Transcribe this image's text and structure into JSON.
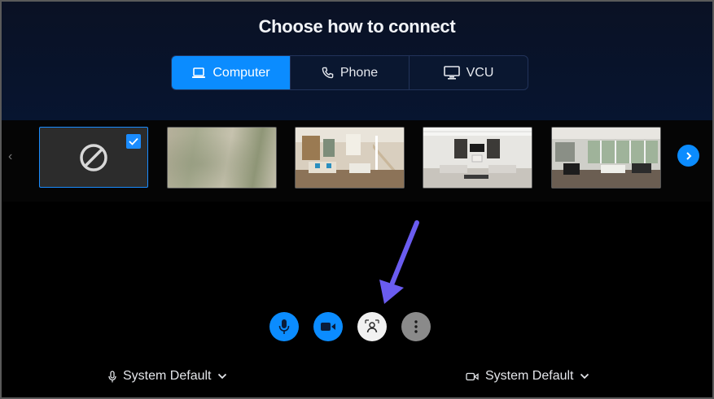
{
  "header": {
    "title": "Choose how to connect"
  },
  "tabs": [
    {
      "label": "Computer",
      "icon": "laptop-icon",
      "active": true
    },
    {
      "label": "Phone",
      "icon": "phone-icon",
      "active": false
    },
    {
      "label": "VCU",
      "icon": "monitor-icon",
      "active": false
    }
  ],
  "backgrounds": {
    "items": [
      {
        "kind": "none",
        "icon": "no-background-icon",
        "selected": true
      },
      {
        "kind": "blur",
        "selected": false
      },
      {
        "kind": "image",
        "selected": false
      },
      {
        "kind": "image",
        "selected": false
      },
      {
        "kind": "image",
        "selected": false
      }
    ]
  },
  "controls": {
    "mic": {
      "icon": "microphone-icon",
      "color": "#0b8cff"
    },
    "camera": {
      "icon": "video-camera-icon",
      "color": "#0b8cff"
    },
    "background": {
      "icon": "virtual-background-icon",
      "color": "#f1f1f1"
    },
    "more": {
      "icon": "more-vertical-icon",
      "color": "#8a8a8a"
    }
  },
  "devices": {
    "microphone": {
      "label": "System Default",
      "icon": "microphone-icon"
    },
    "camera": {
      "label": "System Default",
      "icon": "video-camera-icon"
    }
  },
  "colors": {
    "accent": "#0b8cff",
    "annotation": "#6a5cf0"
  }
}
